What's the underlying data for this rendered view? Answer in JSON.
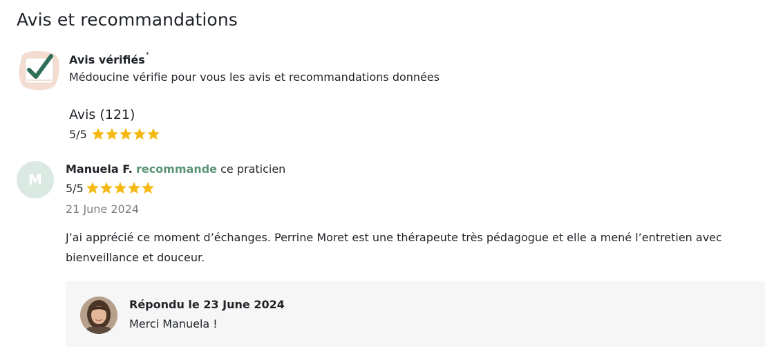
{
  "section": {
    "title": "Avis et recommandations"
  },
  "verified": {
    "title": "Avis vérifiés",
    "mark": "*",
    "description": "Médoucine vérifie pour vous les avis et recommandations données"
  },
  "summary": {
    "title": "Avis (121)",
    "rating_text": "5/5",
    "stars": 5
  },
  "review": {
    "avatar_letter": "M",
    "author": "Manuela F.",
    "recommends": "recommande",
    "tail": "ce praticien",
    "rating_text": "5/5",
    "stars": 5,
    "date": "21 June 2024",
    "text": "J’ai apprécié ce moment d’échanges. Perrine Moret est une thérapeute très pédagogue et elle a mené l’entretien avec bienveillance et douceur."
  },
  "reply": {
    "title": "Répondu le 23 June 2024",
    "text": "Merci Manuela !"
  },
  "colors": {
    "star": "#f5b914",
    "recommend_green": "#5a9477",
    "avatar_bg": "#dbe9e3",
    "reply_bg": "#f6f6f6",
    "date_gray": "#7a7f85"
  }
}
